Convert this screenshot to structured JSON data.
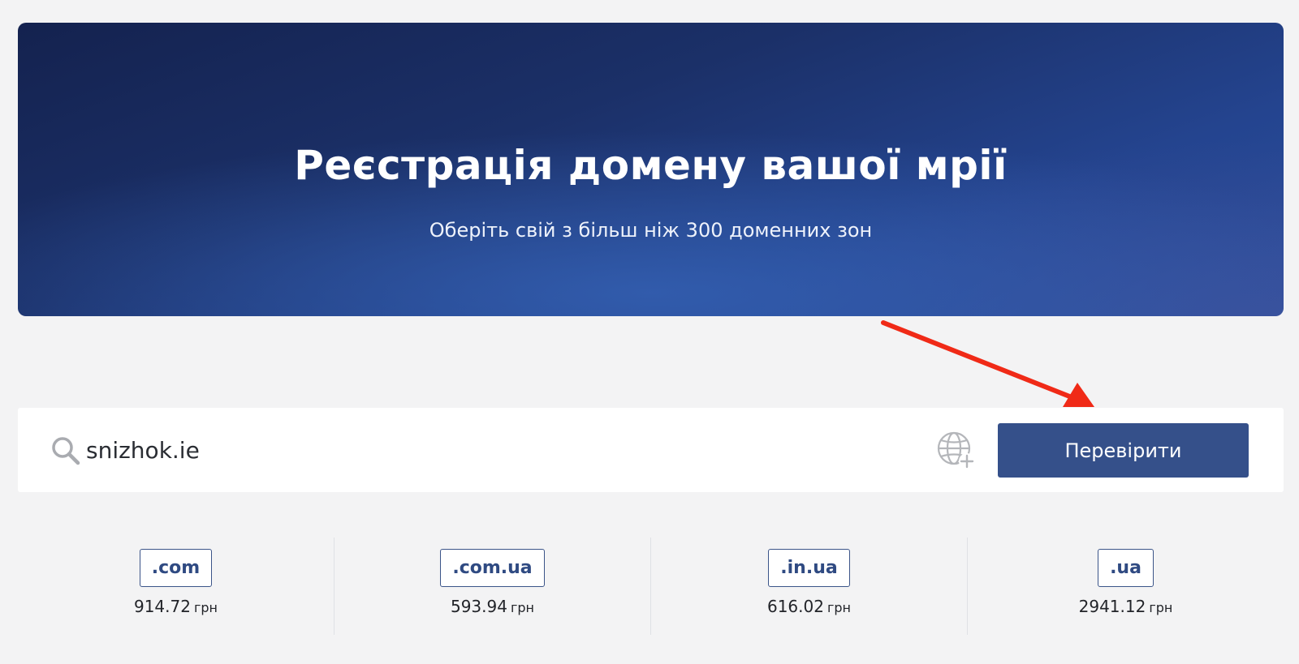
{
  "hero": {
    "title": "Реєстрація домену вашої мрії",
    "subtitle": "Оберіть свій з більш ніж 300 доменних зон"
  },
  "search": {
    "value": "snizhok.ie",
    "icon": "search-icon",
    "globe_icon": "globe-plus-icon",
    "button_label": "Перевірити"
  },
  "zones": [
    {
      "name": ".com",
      "price": "914.72",
      "currency": "грн"
    },
    {
      "name": ".com.ua",
      "price": "593.94",
      "currency": "грн"
    },
    {
      "name": ".in.ua",
      "price": "616.02",
      "currency": "грн"
    },
    {
      "name": ".ua",
      "price": "2941.12",
      "currency": "грн"
    }
  ],
  "colors": {
    "accent": "#35508a",
    "annotation_arrow": "#f02a17"
  }
}
